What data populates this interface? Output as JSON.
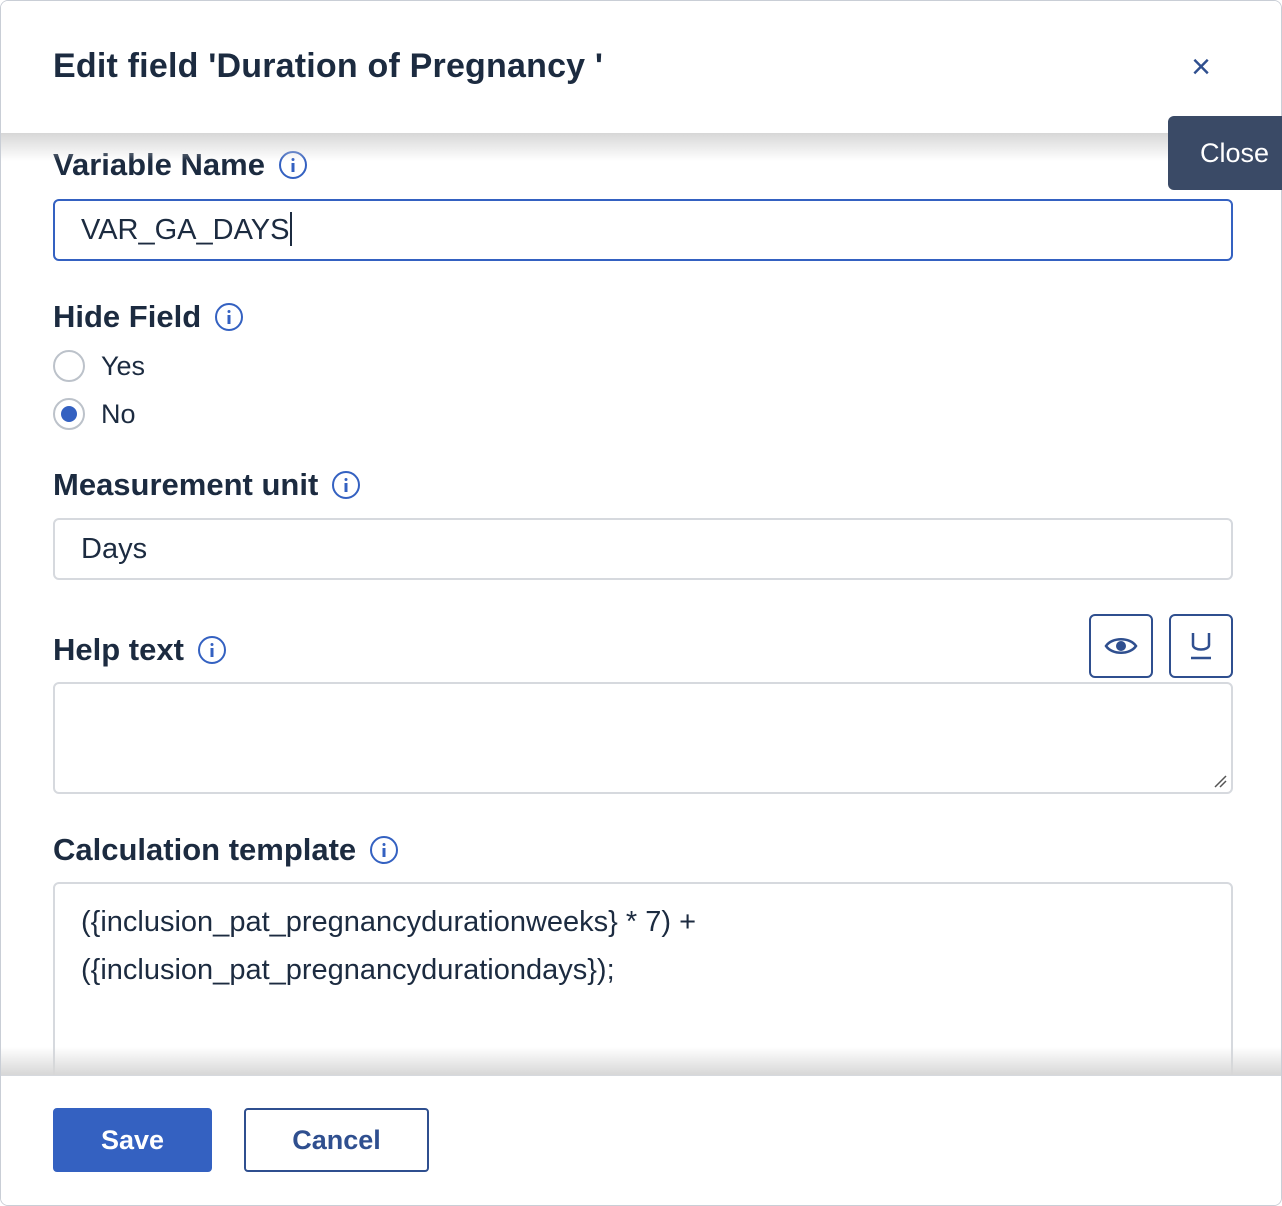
{
  "dialog": {
    "title": "Edit field 'Duration of Pregnancy '",
    "close_glyph": "×",
    "close_tooltip": "Close"
  },
  "variable_name": {
    "label": "Variable Name",
    "value": "VAR_GA_DAYS"
  },
  "hide_field": {
    "label": "Hide Field",
    "options": [
      {
        "label": "Yes",
        "checked": false
      },
      {
        "label": "No",
        "checked": true
      }
    ]
  },
  "measurement_unit": {
    "label": "Measurement unit",
    "value": "Days"
  },
  "help_text": {
    "label": "Help text",
    "value": "",
    "toolbar": [
      "eye-icon",
      "underline-icon"
    ]
  },
  "calculation_template": {
    "label": "Calculation template",
    "lines": [
      "({inclusion_pat_pregnancydurationweeks} * 7) +",
      "({inclusion_pat_pregnancydurationdays});"
    ]
  },
  "footer": {
    "save_label": "Save",
    "cancel_label": "Cancel"
  },
  "colors": {
    "accent": "#3461c1",
    "text": "#1c2b40",
    "tooltip_bg": "#3a4a66",
    "border": "#d6d9de"
  }
}
